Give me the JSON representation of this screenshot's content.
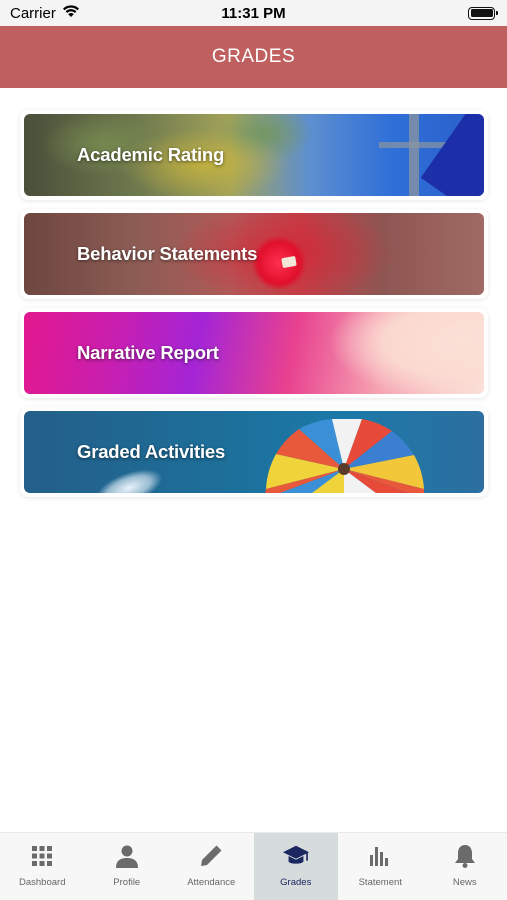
{
  "status_bar": {
    "carrier": "Carrier",
    "time": "11:31 PM"
  },
  "header": {
    "title": "GRADES",
    "background_color": "#bf5f5f"
  },
  "menu_cards": [
    {
      "label": "Academic Rating",
      "image": "landscape-photo"
    },
    {
      "label": "Behavior Statements",
      "image": "red-bulb-photo"
    },
    {
      "label": "Narrative Report",
      "image": "pink-gradient-photo"
    },
    {
      "label": "Graded Activities",
      "image": "parachute-photo"
    }
  ],
  "tab_bar": {
    "active_color": "#1a2760",
    "active_background": "#d6dbdc",
    "items": [
      {
        "label": "Dashboard",
        "icon": "grid-icon",
        "active": false
      },
      {
        "label": "Profile",
        "icon": "person-icon",
        "active": false
      },
      {
        "label": "Attendance",
        "icon": "pencil-icon",
        "active": false
      },
      {
        "label": "Grades",
        "icon": "graduation-cap-icon",
        "active": true
      },
      {
        "label": "Statement",
        "icon": "bar-chart-icon",
        "active": false
      },
      {
        "label": "News",
        "icon": "bell-icon",
        "active": false
      }
    ]
  }
}
